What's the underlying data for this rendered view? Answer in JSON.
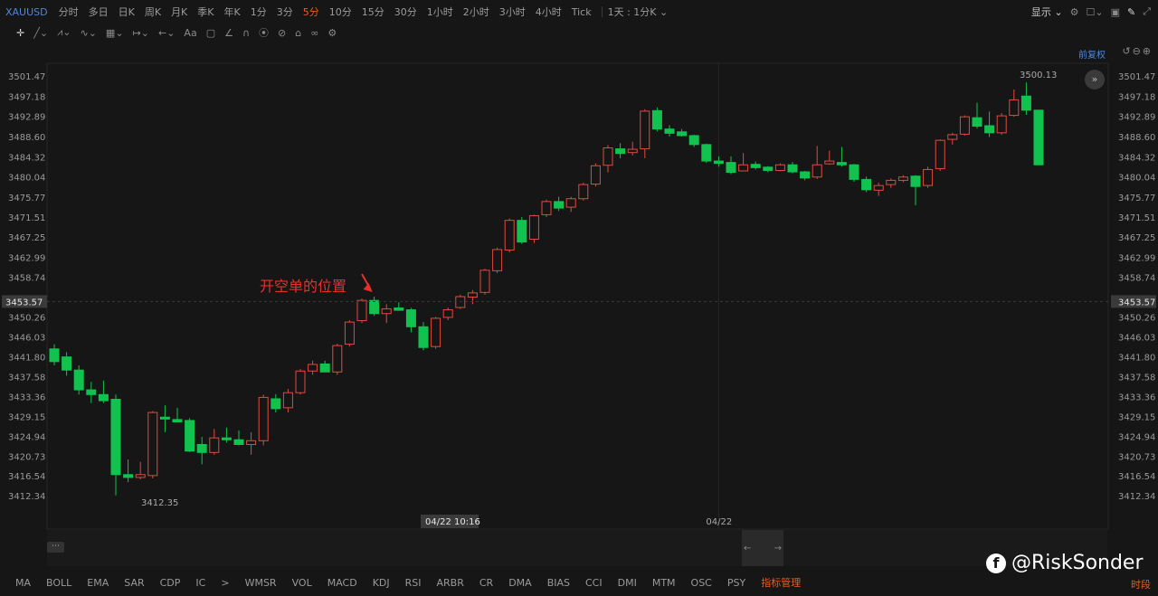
{
  "toolbar": {
    "symbol": "XAUUSD",
    "timeframes": [
      "分时",
      "多日",
      "日K",
      "周K",
      "月K",
      "季K",
      "年K",
      "1分",
      "3分",
      "5分",
      "10分",
      "15分",
      "30分",
      "1小时",
      "2小时",
      "3小时",
      "4小时",
      "Tick"
    ],
    "active_timeframe": "5分",
    "compare": "1天 : 1分K",
    "display": "显示"
  },
  "drawbar": {
    "text_tool": "Aa"
  },
  "adjust_label": "前复权",
  "colors": {
    "up": "#e04a3f",
    "down": "#11c24f",
    "accent": "#e85d24",
    "link": "#4f86d9",
    "annotation": "#e8302a"
  },
  "chart_data": {
    "type": "candlestick",
    "interval": "5分",
    "y_ticks": [
      3501.47,
      3497.18,
      3492.89,
      3488.6,
      3484.32,
      3480.04,
      3475.77,
      3471.51,
      3467.25,
      3462.99,
      3458.74,
      3453.57,
      3450.26,
      3446.03,
      3441.8,
      3437.58,
      3433.36,
      3429.15,
      3424.94,
      3420.73,
      3416.54,
      3412.34
    ],
    "ylim": [
      3410.5,
      3504.5
    ],
    "current_price": 3453.57,
    "crosshair_x_label": "04/22 10:16",
    "date_label": "04/22",
    "high_label": "3500.13",
    "low_label": "3412.35",
    "annotation": "开空单的位置",
    "annotation_index": 27,
    "candles": [
      {
        "o": 3443.5,
        "h": 3444.5,
        "l": 3440.0,
        "c": 3440.8
      },
      {
        "o": 3441.8,
        "h": 3442.8,
        "l": 3437.8,
        "c": 3439.0
      },
      {
        "o": 3439.0,
        "h": 3440.0,
        "l": 3433.8,
        "c": 3434.8
      },
      {
        "o": 3434.8,
        "h": 3436.5,
        "l": 3432.0,
        "c": 3433.8
      },
      {
        "o": 3433.8,
        "h": 3436.8,
        "l": 3432.0,
        "c": 3432.5
      },
      {
        "o": 3432.8,
        "h": 3433.8,
        "l": 3412.4,
        "c": 3416.8
      },
      {
        "o": 3416.8,
        "h": 3420.0,
        "l": 3415.2,
        "c": 3416.2
      },
      {
        "o": 3416.2,
        "h": 3419.5,
        "l": 3415.8,
        "c": 3416.8
      },
      {
        "o": 3416.6,
        "h": 3430.3,
        "l": 3416.0,
        "c": 3430.0
      },
      {
        "o": 3429.0,
        "h": 3431.5,
        "l": 3425.8,
        "c": 3428.6
      },
      {
        "o": 3428.5,
        "h": 3431.0,
        "l": 3428.0,
        "c": 3428.0
      },
      {
        "o": 3428.3,
        "h": 3428.8,
        "l": 3421.6,
        "c": 3421.8
      },
      {
        "o": 3423.2,
        "h": 3424.8,
        "l": 3419.0,
        "c": 3421.5
      },
      {
        "o": 3421.5,
        "h": 3426.5,
        "l": 3421.0,
        "c": 3424.6
      },
      {
        "o": 3424.6,
        "h": 3426.8,
        "l": 3423.6,
        "c": 3424.2
      },
      {
        "o": 3424.2,
        "h": 3426.2,
        "l": 3423.0,
        "c": 3423.2
      },
      {
        "o": 3423.2,
        "h": 3425.8,
        "l": 3421.0,
        "c": 3424.0
      },
      {
        "o": 3424.0,
        "h": 3433.8,
        "l": 3423.0,
        "c": 3433.2
      },
      {
        "o": 3432.9,
        "h": 3433.9,
        "l": 3430.0,
        "c": 3430.8
      },
      {
        "o": 3431.0,
        "h": 3435.0,
        "l": 3430.0,
        "c": 3434.2
      },
      {
        "o": 3434.2,
        "h": 3439.2,
        "l": 3433.8,
        "c": 3438.8
      },
      {
        "o": 3438.8,
        "h": 3441.0,
        "l": 3438.0,
        "c": 3440.2
      },
      {
        "o": 3440.3,
        "h": 3441.0,
        "l": 3438.6,
        "c": 3438.6
      },
      {
        "o": 3438.6,
        "h": 3444.6,
        "l": 3438.0,
        "c": 3444.2
      },
      {
        "o": 3444.5,
        "h": 3449.6,
        "l": 3444.0,
        "c": 3449.2
      },
      {
        "o": 3449.5,
        "h": 3454.2,
        "l": 3449.0,
        "c": 3453.8
      },
      {
        "o": 3453.8,
        "h": 3454.6,
        "l": 3450.5,
        "c": 3451.0
      },
      {
        "o": 3451.0,
        "h": 3453.0,
        "l": 3449.0,
        "c": 3452.0
      },
      {
        "o": 3452.2,
        "h": 3453.4,
        "l": 3451.6,
        "c": 3451.7
      },
      {
        "o": 3451.8,
        "h": 3452.2,
        "l": 3447.0,
        "c": 3448.2
      },
      {
        "o": 3448.2,
        "h": 3449.2,
        "l": 3443.2,
        "c": 3443.8
      },
      {
        "o": 3444.0,
        "h": 3450.3,
        "l": 3443.5,
        "c": 3450.0
      },
      {
        "o": 3450.2,
        "h": 3452.3,
        "l": 3449.6,
        "c": 3451.8
      },
      {
        "o": 3452.3,
        "h": 3455.0,
        "l": 3452.0,
        "c": 3454.6
      },
      {
        "o": 3454.5,
        "h": 3456.0,
        "l": 3453.0,
        "c": 3455.4
      },
      {
        "o": 3455.5,
        "h": 3460.5,
        "l": 3455.0,
        "c": 3460.2
      },
      {
        "o": 3460.1,
        "h": 3465.0,
        "l": 3459.6,
        "c": 3464.6
      },
      {
        "o": 3464.5,
        "h": 3471.2,
        "l": 3464.0,
        "c": 3470.8
      },
      {
        "o": 3470.8,
        "h": 3471.5,
        "l": 3465.8,
        "c": 3466.2
      },
      {
        "o": 3466.8,
        "h": 3472.0,
        "l": 3466.0,
        "c": 3471.8
      },
      {
        "o": 3472.0,
        "h": 3475.2,
        "l": 3471.5,
        "c": 3474.8
      },
      {
        "o": 3474.8,
        "h": 3475.8,
        "l": 3472.8,
        "c": 3473.4
      },
      {
        "o": 3473.6,
        "h": 3475.8,
        "l": 3472.6,
        "c": 3475.4
      },
      {
        "o": 3475.4,
        "h": 3478.8,
        "l": 3475.0,
        "c": 3478.4
      },
      {
        "o": 3478.5,
        "h": 3482.9,
        "l": 3478.0,
        "c": 3482.4
      },
      {
        "o": 3482.5,
        "h": 3486.8,
        "l": 3481.0,
        "c": 3486.2
      },
      {
        "o": 3486.0,
        "h": 3487.2,
        "l": 3484.0,
        "c": 3485.0
      },
      {
        "o": 3485.2,
        "h": 3487.5,
        "l": 3484.6,
        "c": 3485.9
      },
      {
        "o": 3486.0,
        "h": 3494.4,
        "l": 3484.0,
        "c": 3494.0
      },
      {
        "o": 3494.1,
        "h": 3494.8,
        "l": 3489.7,
        "c": 3490.2
      },
      {
        "o": 3490.2,
        "h": 3491.0,
        "l": 3488.6,
        "c": 3489.3
      },
      {
        "o": 3489.6,
        "h": 3490.2,
        "l": 3488.6,
        "c": 3488.8
      },
      {
        "o": 3488.8,
        "h": 3489.0,
        "l": 3486.4,
        "c": 3486.9
      },
      {
        "o": 3486.9,
        "h": 3487.1,
        "l": 3483.0,
        "c": 3483.4
      },
      {
        "o": 3483.4,
        "h": 3484.4,
        "l": 3482.2,
        "c": 3482.9
      },
      {
        "o": 3483.1,
        "h": 3484.4,
        "l": 3480.6,
        "c": 3481.0
      },
      {
        "o": 3481.3,
        "h": 3485.1,
        "l": 3481.3,
        "c": 3482.6
      },
      {
        "o": 3482.7,
        "h": 3483.3,
        "l": 3481.6,
        "c": 3482.0
      },
      {
        "o": 3482.1,
        "h": 3482.3,
        "l": 3481.0,
        "c": 3481.4
      },
      {
        "o": 3481.4,
        "h": 3482.9,
        "l": 3481.2,
        "c": 3482.6
      },
      {
        "o": 3482.6,
        "h": 3483.2,
        "l": 3480.8,
        "c": 3481.1
      },
      {
        "o": 3481.1,
        "h": 3481.3,
        "l": 3479.3,
        "c": 3479.8
      },
      {
        "o": 3480.0,
        "h": 3486.6,
        "l": 3479.6,
        "c": 3482.6
      },
      {
        "o": 3482.8,
        "h": 3485.6,
        "l": 3482.6,
        "c": 3483.4
      },
      {
        "o": 3483.1,
        "h": 3486.4,
        "l": 3482.2,
        "c": 3482.6
      },
      {
        "o": 3482.6,
        "h": 3482.8,
        "l": 3479.0,
        "c": 3479.5
      },
      {
        "o": 3479.5,
        "h": 3480.1,
        "l": 3476.8,
        "c": 3477.3
      },
      {
        "o": 3477.2,
        "h": 3478.8,
        "l": 3476.0,
        "c": 3478.2
      },
      {
        "o": 3478.4,
        "h": 3479.7,
        "l": 3477.7,
        "c": 3479.3
      },
      {
        "o": 3479.3,
        "h": 3480.4,
        "l": 3478.9,
        "c": 3480.0
      },
      {
        "o": 3480.2,
        "h": 3480.4,
        "l": 3474.0,
        "c": 3478.0
      },
      {
        "o": 3478.2,
        "h": 3482.2,
        "l": 3477.7,
        "c": 3481.6
      },
      {
        "o": 3481.8,
        "h": 3488.0,
        "l": 3481.3,
        "c": 3487.8
      },
      {
        "o": 3488.0,
        "h": 3489.4,
        "l": 3486.9,
        "c": 3489.0
      },
      {
        "o": 3489.1,
        "h": 3493.1,
        "l": 3488.8,
        "c": 3492.8
      },
      {
        "o": 3492.6,
        "h": 3495.8,
        "l": 3490.3,
        "c": 3490.8
      },
      {
        "o": 3490.9,
        "h": 3493.9,
        "l": 3488.5,
        "c": 3489.4
      },
      {
        "o": 3489.4,
        "h": 3493.6,
        "l": 3489.0,
        "c": 3493.0
      },
      {
        "o": 3493.1,
        "h": 3498.6,
        "l": 3492.8,
        "c": 3496.4
      },
      {
        "o": 3497.2,
        "h": 3500.1,
        "l": 3493.2,
        "c": 3494.2
      },
      {
        "o": 3494.2,
        "h": 3494.3,
        "l": 3482.6,
        "c": 3482.6
      }
    ]
  },
  "indicators": [
    "MA",
    "BOLL",
    "EMA",
    "SAR",
    "CDP",
    "IC",
    ">",
    "WMSR",
    "VOL",
    "MACD",
    "KDJ",
    "RSI",
    "ARBR",
    "CR",
    "DMA",
    "BIAS",
    "CCI",
    "DMI",
    "MTM",
    "OSC",
    "PSY"
  ],
  "indicator_manager": "指标管理",
  "period_tab": "时段",
  "watermark": "@RiskSonder"
}
